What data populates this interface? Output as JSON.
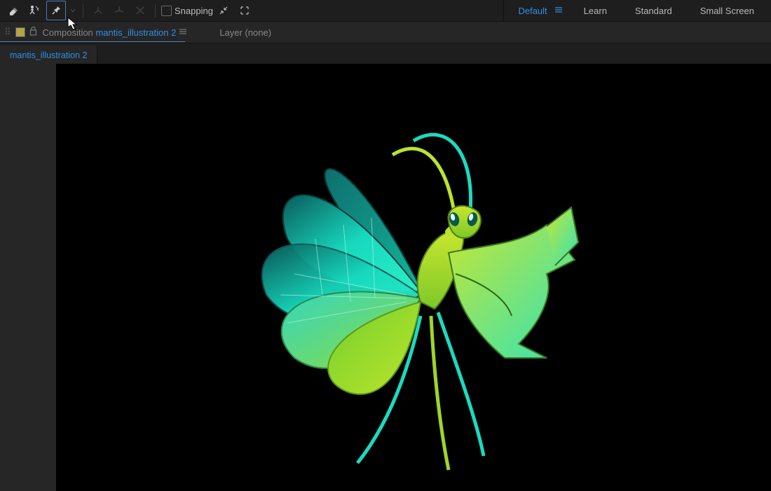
{
  "toolbar": {
    "snapping_label": "Snapping"
  },
  "workspaces": {
    "default": "Default",
    "learn": "Learn",
    "standard": "Standard",
    "small_screen": "Small Screen"
  },
  "panel": {
    "composition_label": "Composition",
    "composition_name": "mantis_illustration 2",
    "layer_label": "Layer (none)"
  },
  "tabs": {
    "active": "mantis_illustration 2"
  }
}
